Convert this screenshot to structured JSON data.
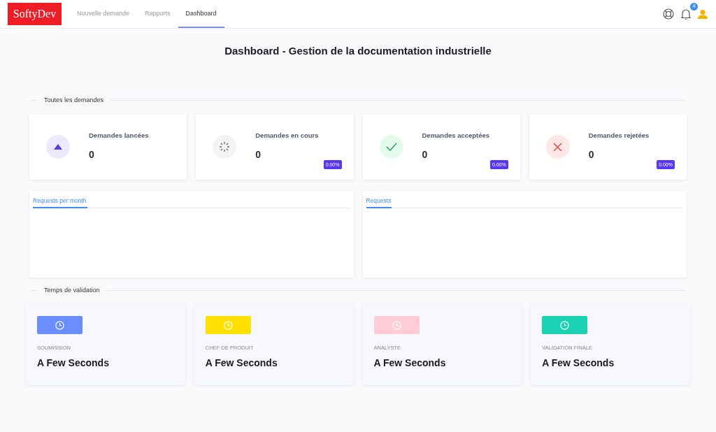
{
  "brand": "SoftyDev",
  "nav": [
    {
      "label": "Nouvelle demande",
      "selected": false
    },
    {
      "label": "Rapports",
      "selected": false
    },
    {
      "label": "Dashboard",
      "selected": true
    }
  ],
  "notifications": {
    "count": "4"
  },
  "title": "Dashboard - Gestion de la documentation industrielle",
  "section_requests": "Toutes les demandes",
  "stats": [
    {
      "kind": "up",
      "label": "Demandes lancées",
      "value": "0"
    },
    {
      "kind": "spinner",
      "label": "Demandes en cours",
      "value": "0",
      "badge": "0.00%"
    },
    {
      "kind": "check",
      "label": "Demandes acceptées",
      "value": "0",
      "badge": "0.00%"
    },
    {
      "kind": "cross",
      "label": "Demandes rejetées",
      "value": "0",
      "badge": "0.00%"
    }
  ],
  "panels": [
    {
      "tab": "Requests per month"
    },
    {
      "tab": "Requests"
    }
  ],
  "section_validation": "Temps de validation",
  "timings": [
    {
      "label": "SOUMISSION",
      "value": "A Few Seconds",
      "color": "#6a8dff"
    },
    {
      "label": "CHEF DE PRODUIT",
      "value": "A Few Seconds",
      "color": "#ffe000"
    },
    {
      "label": "ANALYSTE",
      "value": "A Few Seconds",
      "color": "#ffccd5"
    },
    {
      "label": "VALIDATION FINALE",
      "value": "A Few Seconds",
      "color": "#1ad1b2"
    }
  ]
}
